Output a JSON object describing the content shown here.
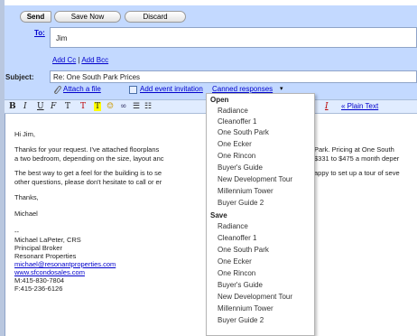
{
  "buttons": {
    "send": "Send",
    "save_now": "Save Now",
    "discard": "Discard"
  },
  "to": {
    "label": "To:",
    "value": "Jim"
  },
  "add_links": {
    "cc": "Add Cc",
    "sep": "|",
    "bcc": "Add Bcc"
  },
  "subject": {
    "label": "Subject:",
    "value": "Re: One South Park Prices"
  },
  "attach_row": {
    "attach": "Attach a file",
    "event": "Add event invitation",
    "canned": "Canned responses",
    "arrow": "▾"
  },
  "toolbar": {
    "bold": "B",
    "italic": "I",
    "underline": "U",
    "font": "F",
    "size": "T",
    "textcolor": "T",
    "highlight": "T",
    "smiley": "☺",
    "link": "∞",
    "numbered": "☰",
    "bulleted": "☷",
    "remove_format": "I",
    "plain_text": "« Plain Text"
  },
  "body": {
    "greeting": "Hi Jim,",
    "p1_left": "Thanks for your request. I've attached floorplans",
    "p1_right": "Park. Pricing at One South",
    "p2_left": "a two bedroom, depending on the size, layout anc",
    "p2_right": "$331 to $475 a month deper",
    "p3_left": "The best way to get a feel for the building is to se",
    "p3_right": "appy to set up a tour of seve",
    "p4_left": "other questions, please don't hesitate to call or er",
    "thanks": "Thanks,",
    "name": "Michael",
    "dashes": "--",
    "sig_name": "Michael LaPeter, CRS",
    "sig_title": "Principal Broker",
    "sig_company": "Resonant Properties",
    "sig_email": "michael@resonantproperties.com",
    "sig_web": "www.sfcondosales.com",
    "sig_mobile": "M:415-830-7804",
    "sig_fax": "F:415-236-6126"
  },
  "menu": {
    "open_header": "Open",
    "open_items": [
      "Radiance",
      "Cleanoffer 1",
      "One South Park",
      "One Ecker",
      "One Rincon",
      "Buyer's Guide",
      "New Development Tour",
      "Millennium Tower",
      "Buyer Guide 2"
    ],
    "save_header": "Save",
    "save_items": [
      "Radiance",
      "Cleanoffer 1",
      "One South Park",
      "One Ecker",
      "One Rincon",
      "Buyer's Guide",
      "New Development Tour",
      "Millennium Tower",
      "Buyer Guide 2"
    ]
  },
  "colors": {
    "compose_bg": "#c3d9ff",
    "link": "#0000cc",
    "toolbar_bg": "#e0ecff"
  }
}
